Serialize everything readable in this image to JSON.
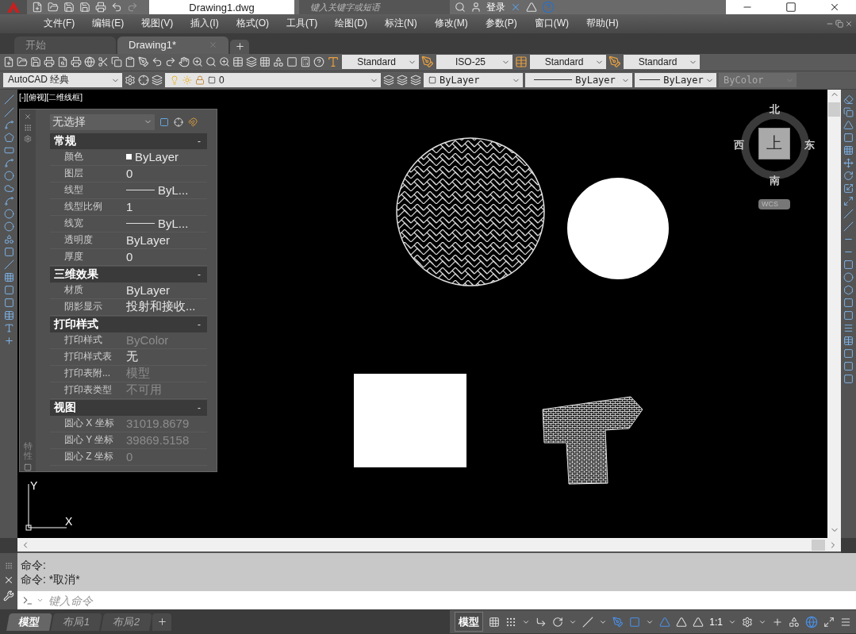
{
  "title_bar": {
    "document_title": "Drawing1.dwg",
    "search": {
      "placeholder": "键入关键字或短语"
    },
    "sign_in": "登录"
  },
  "menu_bar": [
    "文件(F)",
    "编辑(E)",
    "视图(V)",
    "插入(I)",
    "格式(O)",
    "工具(T)",
    "绘图(D)",
    "标注(N)",
    "修改(M)",
    "参数(P)",
    "窗口(W)",
    "帮助(H)"
  ],
  "file_tabs": [
    {
      "label": "开始",
      "selected": false
    },
    {
      "label": "Drawing1*",
      "selected": true
    }
  ],
  "style_dropdowns": [
    "Standard",
    "ISO-25",
    "Standard",
    "Standard"
  ],
  "property_toolbar": {
    "workspace": "AutoCAD 经典",
    "layer": "0",
    "color_setting": "ByLayer",
    "linetype": "ByLayer",
    "lineweight": "ByLayer",
    "plot_style": {
      "value": "ByColor",
      "disabled": true
    }
  },
  "viewport_label": "[-][俯视][二维线框]",
  "properties_palette": {
    "selection": "无选择",
    "side_label": "特性",
    "sections": [
      {
        "title": "常规",
        "toggle": "-",
        "rows": [
          {
            "label": "颜色",
            "value": "ByLayer",
            "kind": "color",
            "disabled": false
          },
          {
            "label": "图层",
            "value": "0",
            "kind": "text",
            "disabled": false
          },
          {
            "label": "线型",
            "value": "ByL...",
            "kind": "line",
            "disabled": false
          },
          {
            "label": "线型比例",
            "value": "1",
            "kind": "text",
            "disabled": false
          },
          {
            "label": "线宽",
            "value": "ByL...",
            "kind": "line",
            "disabled": false
          },
          {
            "label": "透明度",
            "value": "ByLayer",
            "kind": "text",
            "disabled": false
          },
          {
            "label": "厚度",
            "value": "0",
            "kind": "text",
            "disabled": false
          }
        ]
      },
      {
        "title": "三维效果",
        "toggle": "-",
        "rows": [
          {
            "label": "材质",
            "value": "ByLayer",
            "kind": "text",
            "disabled": false
          },
          {
            "label": "阴影显示",
            "value": "投射和接收...",
            "kind": "text",
            "disabled": false
          }
        ]
      },
      {
        "title": "打印样式",
        "toggle": "-",
        "rows": [
          {
            "label": "打印样式",
            "value": "ByColor",
            "kind": "text",
            "disabled": true
          },
          {
            "label": "打印样式表",
            "value": "无",
            "kind": "text",
            "disabled": false
          },
          {
            "label": "打印表附...",
            "value": "模型",
            "kind": "text",
            "disabled": true
          },
          {
            "label": "打印表类型",
            "value": "不可用",
            "kind": "text",
            "disabled": true
          }
        ]
      },
      {
        "title": "视图",
        "toggle": "-",
        "rows": [
          {
            "label": "圆心 X 坐标",
            "value": "31019.8679",
            "kind": "text",
            "disabled": true
          },
          {
            "label": "圆心 Y 坐标",
            "value": "39869.5158",
            "kind": "text",
            "disabled": true
          },
          {
            "label": "圆心 Z 坐标",
            "value": "0",
            "kind": "text",
            "disabled": true
          }
        ]
      }
    ]
  },
  "viewcube": {
    "north": "北",
    "south": "南",
    "west": "西",
    "east": "东",
    "face": "上",
    "wcs": "WCS"
  },
  "ucs": {
    "x": "X",
    "y": "Y"
  },
  "command_line": {
    "history": [
      "命令:",
      "命令: *取消*"
    ],
    "placeholder": "键入命令"
  },
  "layout_tabs": [
    {
      "label": "模型",
      "selected": true
    },
    {
      "label": "布局1",
      "selected": false
    },
    {
      "label": "布局2",
      "selected": false
    }
  ],
  "status_bar": {
    "model": "模型",
    "scale": "1:1"
  }
}
